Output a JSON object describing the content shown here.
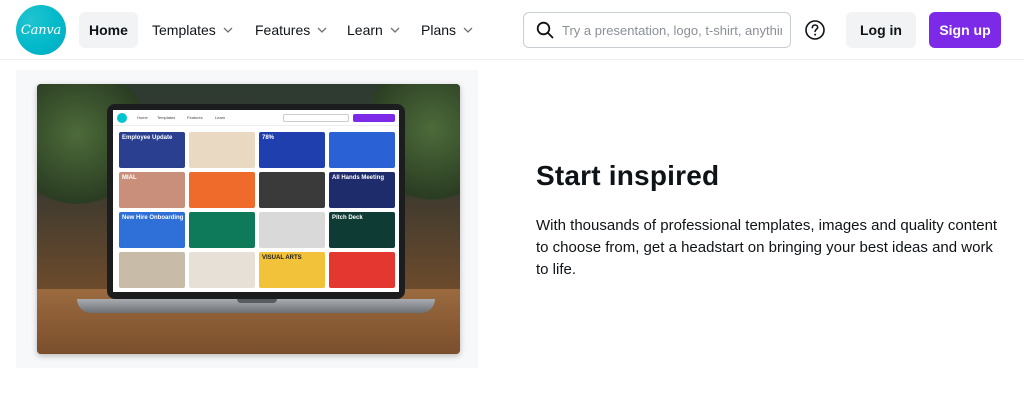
{
  "header": {
    "logo_text": "Canva",
    "nav": [
      {
        "label": "Home",
        "active": true
      },
      {
        "label": "Templates",
        "active": false
      },
      {
        "label": "Features",
        "active": false
      },
      {
        "label": "Learn",
        "active": false
      },
      {
        "label": "Plans",
        "active": false
      }
    ],
    "search_placeholder": "Try a presentation, logo, t-shirt, anything",
    "login_label": "Log in",
    "signup_label": "Sign up"
  },
  "hero": {
    "title": "Start inspired",
    "description": "With thousands of professional templates, images and quality content to choose from, get a headstart on bringing your best ideas and work to life."
  },
  "screen": {
    "nav_links": [
      "Home",
      "Templates",
      "Features",
      "Learn"
    ],
    "tiles": [
      {
        "text": "Employee Update",
        "color": "#2a3f8f"
      },
      {
        "text": "",
        "color": "#e9d9c3"
      },
      {
        "text": "78%",
        "color": "#1f3fae"
      },
      {
        "text": "",
        "color": "#2a62d6"
      },
      {
        "text": "MIAL",
        "color": "#c98f7a"
      },
      {
        "text": "",
        "color": "#ef6b2c"
      },
      {
        "text": "",
        "color": "#3a3a3a"
      },
      {
        "text": "All Hands Meeting",
        "color": "#1e2c6b"
      },
      {
        "text": "New Hire Onboarding",
        "color": "#2f6fd8"
      },
      {
        "text": "",
        "color": "#0f7a5a"
      },
      {
        "text": "",
        "color": "#d9d9d9"
      },
      {
        "text": "Pitch Deck",
        "color": "#0e3b34"
      },
      {
        "text": "",
        "color": "#c8bba8"
      },
      {
        "text": "",
        "color": "#e6e0d6"
      },
      {
        "text": "VISUAL ARTS",
        "color": "#f2c23a"
      },
      {
        "text": "",
        "color": "#e3372f"
      }
    ]
  },
  "colors": {
    "brand": "#00c4cc",
    "accent": "#7d2ae8"
  },
  "icons": {
    "search": "search-icon",
    "help": "help-circle-icon",
    "chevron": "chevron-down-icon"
  }
}
